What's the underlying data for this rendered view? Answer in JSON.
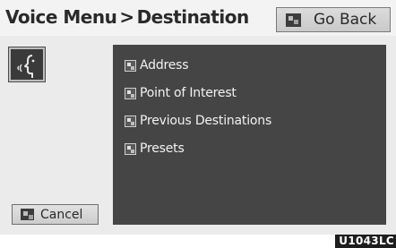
{
  "header": {
    "title_part1": "Voice Menu",
    "title_separator": ">",
    "title_part2": "Destination",
    "go_back_label": "Go Back"
  },
  "voice_icon": "voice-recognition-icon",
  "menu": {
    "items": [
      {
        "label": "Address",
        "icon": "voice-command-icon"
      },
      {
        "label": "Point of Interest",
        "icon": "voice-command-icon"
      },
      {
        "label": "Previous Destinations",
        "icon": "voice-command-icon"
      },
      {
        "label": "Presets",
        "icon": "voice-command-icon"
      }
    ]
  },
  "footer": {
    "cancel_label": "Cancel"
  },
  "figure_code": "U1043LC",
  "colors": {
    "screen_background": "#ebebeb",
    "panel_background": "#454545",
    "panel_text": "#f2f2f2",
    "button_face": "#d4d4d4",
    "title_text": "#2a2a2a"
  }
}
